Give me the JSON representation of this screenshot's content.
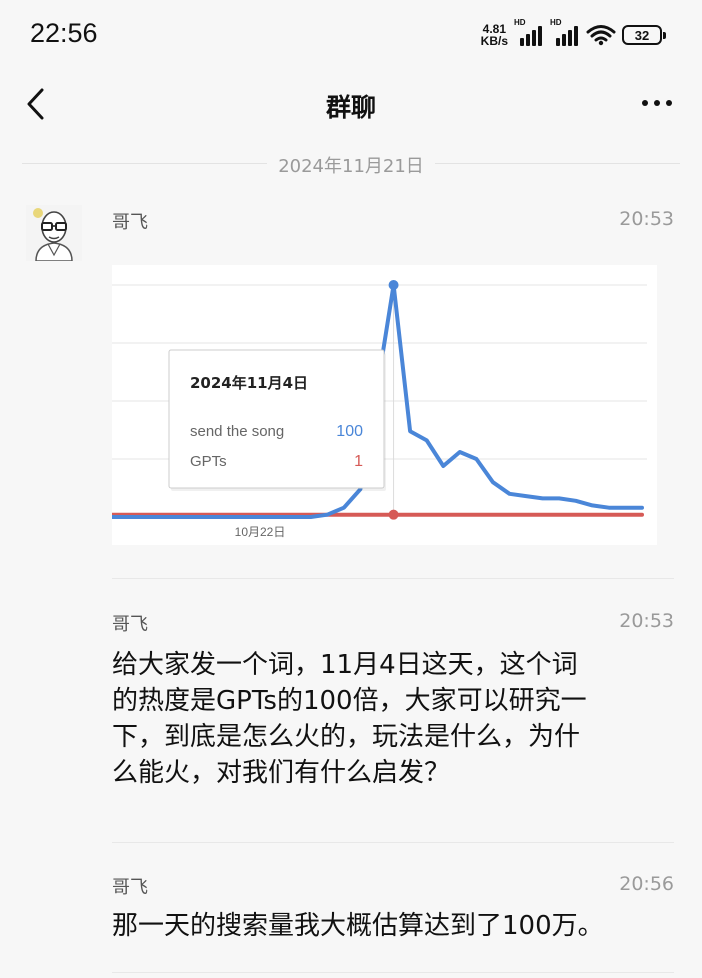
{
  "status_bar": {
    "time": "22:56",
    "net_speed_value": "4.81",
    "net_speed_unit": "KB/s",
    "signal1_label": "HD",
    "signal2_label": "HD",
    "battery": "32"
  },
  "nav": {
    "title": "群聊"
  },
  "date_divider": "2024年11月21日",
  "messages": [
    {
      "sender": "哥飞",
      "time": "20:53",
      "type": "image"
    },
    {
      "sender": "哥飞",
      "time": "20:53",
      "lines": [
        "给大家发一个词，11月4日这天，这个词",
        "的热度是GPTs的100倍，大家可以研究一",
        "下，到底是怎么火的，玩法是什么，为什",
        "么能火，对我们有什么启发？"
      ]
    },
    {
      "sender": "哥飞",
      "time": "20:56",
      "lines": [
        "那一天的搜索量我大概估算达到了100万。"
      ]
    }
  ],
  "chart_data": {
    "type": "line",
    "x_tick_label": "10月22日",
    "ylim": [
      0,
      100
    ],
    "grid": true,
    "series": [
      {
        "name": "send the song",
        "color": "#4a86d8",
        "values": [
          0,
          0,
          0,
          0,
          0,
          0,
          0,
          0,
          0,
          0,
          0,
          0,
          0,
          1,
          4,
          12,
          55,
          100,
          37,
          33,
          22,
          28,
          25,
          15,
          10,
          9,
          8,
          8,
          7,
          5,
          4,
          4,
          4
        ]
      },
      {
        "name": "GPTs",
        "color": "#d65a56",
        "values": [
          1,
          1,
          1,
          1,
          1,
          1,
          1,
          1,
          1,
          1,
          1,
          1,
          1,
          1,
          1,
          1,
          1,
          1,
          1,
          1,
          1,
          1,
          1,
          1,
          1,
          1,
          1,
          1,
          1,
          1,
          1,
          1,
          1
        ]
      }
    ],
    "tooltip": {
      "date": "2024年11月4日",
      "rows": [
        {
          "label": "send the song",
          "value": "100",
          "color": "#4a86d8"
        },
        {
          "label": "GPTs",
          "value": "1",
          "color": "#d65a56"
        }
      ]
    }
  }
}
